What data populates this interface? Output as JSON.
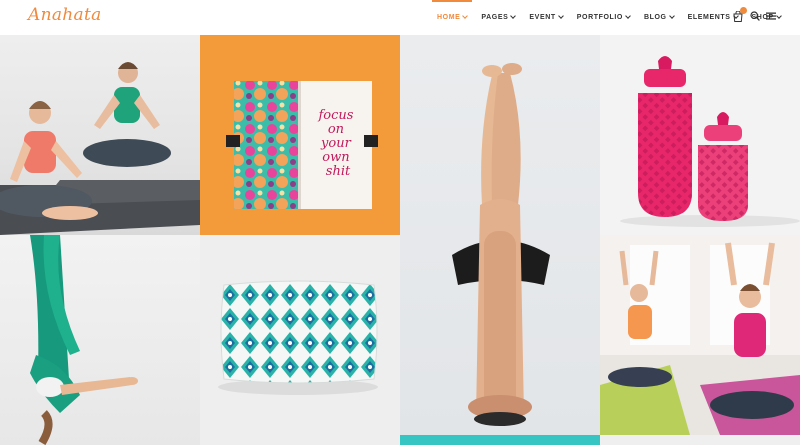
{
  "logo": "Anahata",
  "nav": {
    "items": [
      {
        "label": "HOME",
        "active": true
      },
      {
        "label": "PAGES",
        "active": false
      },
      {
        "label": "EVENT",
        "active": false
      },
      {
        "label": "PORTFOLIO",
        "active": false
      },
      {
        "label": "BLOG",
        "active": false
      },
      {
        "label": "ELEMENTS",
        "active": false
      },
      {
        "label": "SHOP",
        "active": false
      }
    ]
  },
  "header_icons": [
    "cart-icon",
    "search-icon",
    "menu-icon"
  ],
  "gallery": {
    "notebook_text": [
      "focus",
      "on",
      "your",
      "own",
      "shit"
    ]
  },
  "colors": {
    "accent": "#f08a3c",
    "tile_orange": "#f39a3a",
    "teal": "#36c5c2",
    "pink_jar": "#e8276a"
  }
}
